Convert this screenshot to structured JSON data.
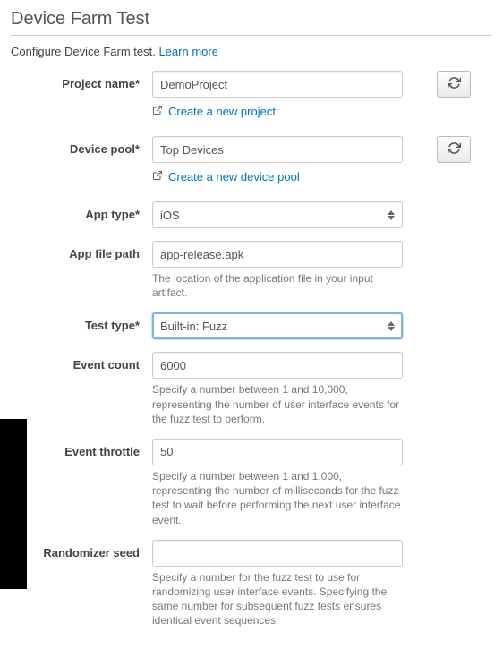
{
  "header": {
    "title": "Device Farm Test",
    "subtitle_prefix": "Configure Device Farm test. ",
    "learn_more_label": "Learn more"
  },
  "fields": {
    "project_name": {
      "label": "Project name*",
      "value": "DemoProject",
      "create_link": "Create a new project"
    },
    "device_pool": {
      "label": "Device pool*",
      "value": "Top Devices",
      "create_link": "Create a new device pool"
    },
    "app_type": {
      "label": "App type*",
      "value": "iOS"
    },
    "app_file_path": {
      "label": "App file path",
      "value": "app-release.apk",
      "helper": "The location of the application file in your input artifact."
    },
    "test_type": {
      "label": "Test type*",
      "value": "Built-in: Fuzz"
    },
    "event_count": {
      "label": "Event count",
      "value": "6000",
      "helper": "Specify a number between 1 and 10,000, representing the number of user interface events for the fuzz test to perform."
    },
    "event_throttle": {
      "label": "Event throttle",
      "value": "50",
      "helper": "Specify a number between 1 and 1,000, representing the number of milliseconds for the fuzz test to wait before performing the next user interface event."
    },
    "randomizer_seed": {
      "label": "Randomizer seed",
      "value": "",
      "helper": "Specify a number for the fuzz test to use for randomizing user interface events. Specifying the same number for subsequent fuzz tests ensures identical event sequences."
    }
  }
}
